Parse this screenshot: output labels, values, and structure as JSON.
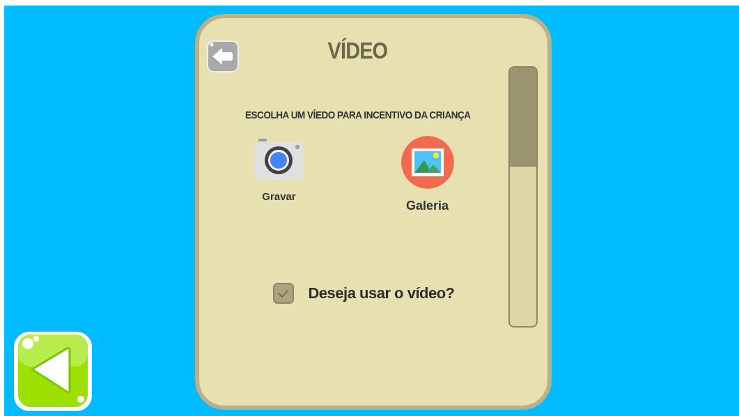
{
  "dialog": {
    "title": "VÍDEO",
    "prompt": "ESCOLHA UM VÍEDO PARA INCENTIVO DA CRIANÇA",
    "options": [
      {
        "kind": "camera",
        "label": "Gravar"
      },
      {
        "kind": "gallery",
        "label": "Galeria"
      }
    ],
    "use_video": {
      "label": "Deseja usar o vídeo?",
      "checked": true
    }
  }
}
